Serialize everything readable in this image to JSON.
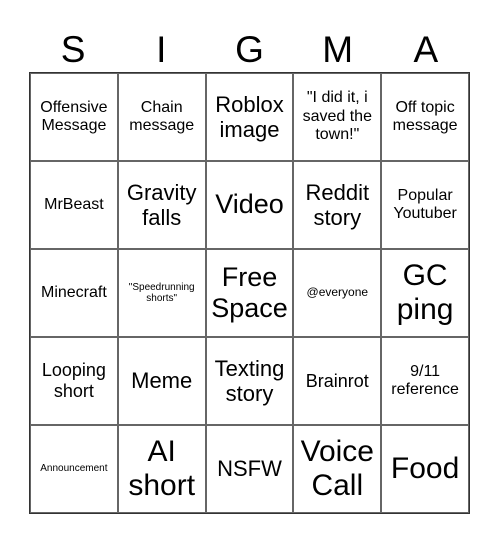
{
  "title_letters": [
    "S",
    "I",
    "G",
    "M",
    "A"
  ],
  "cells": [
    {
      "text": "Offensive Message",
      "size": "s-m"
    },
    {
      "text": "Chain message",
      "size": "s-m"
    },
    {
      "text": "Roblox image",
      "size": "s-xl"
    },
    {
      "text": "\"I did it, i saved the town!\"",
      "size": "s-m"
    },
    {
      "text": "Off topic message",
      "size": "s-m"
    },
    {
      "text": "MrBeast",
      "size": "s-m"
    },
    {
      "text": "Gravity falls",
      "size": "s-xl"
    },
    {
      "text": "Video",
      "size": "s-xxl"
    },
    {
      "text": "Reddit story",
      "size": "s-xl"
    },
    {
      "text": "Popular Youtuber",
      "size": "s-m"
    },
    {
      "text": "Minecraft",
      "size": "s-m"
    },
    {
      "text": "\"Speedrunning shorts\"",
      "size": "s-xs"
    },
    {
      "text": "Free Space",
      "size": "s-xxl"
    },
    {
      "text": "@everyone",
      "size": "s-s"
    },
    {
      "text": "GC ping",
      "size": "s-xxxl"
    },
    {
      "text": "Looping short",
      "size": "s-l"
    },
    {
      "text": "Meme",
      "size": "s-xl"
    },
    {
      "text": "Texting story",
      "size": "s-xl"
    },
    {
      "text": "Brainrot",
      "size": "s-l"
    },
    {
      "text": "9/11 reference",
      "size": "s-m"
    },
    {
      "text": "Announcement",
      "size": "s-xs"
    },
    {
      "text": "AI short",
      "size": "s-xxxl"
    },
    {
      "text": "NSFW",
      "size": "s-xl"
    },
    {
      "text": "Voice Call",
      "size": "s-xxxl"
    },
    {
      "text": "Food",
      "size": "s-xxxl"
    }
  ]
}
